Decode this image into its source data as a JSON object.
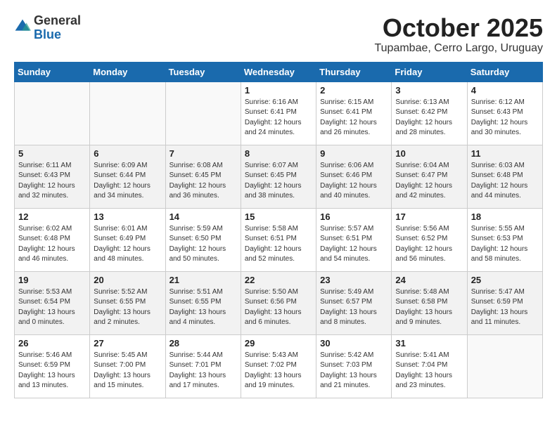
{
  "header": {
    "logo_general": "General",
    "logo_blue": "Blue",
    "month_title": "October 2025",
    "subtitle": "Tupambae, Cerro Largo, Uruguay"
  },
  "weekdays": [
    "Sunday",
    "Monday",
    "Tuesday",
    "Wednesday",
    "Thursday",
    "Friday",
    "Saturday"
  ],
  "weeks": [
    [
      {
        "day": "",
        "info": ""
      },
      {
        "day": "",
        "info": ""
      },
      {
        "day": "",
        "info": ""
      },
      {
        "day": "1",
        "info": "Sunrise: 6:16 AM\nSunset: 6:41 PM\nDaylight: 12 hours\nand 24 minutes."
      },
      {
        "day": "2",
        "info": "Sunrise: 6:15 AM\nSunset: 6:41 PM\nDaylight: 12 hours\nand 26 minutes."
      },
      {
        "day": "3",
        "info": "Sunrise: 6:13 AM\nSunset: 6:42 PM\nDaylight: 12 hours\nand 28 minutes."
      },
      {
        "day": "4",
        "info": "Sunrise: 6:12 AM\nSunset: 6:43 PM\nDaylight: 12 hours\nand 30 minutes."
      }
    ],
    [
      {
        "day": "5",
        "info": "Sunrise: 6:11 AM\nSunset: 6:43 PM\nDaylight: 12 hours\nand 32 minutes."
      },
      {
        "day": "6",
        "info": "Sunrise: 6:09 AM\nSunset: 6:44 PM\nDaylight: 12 hours\nand 34 minutes."
      },
      {
        "day": "7",
        "info": "Sunrise: 6:08 AM\nSunset: 6:45 PM\nDaylight: 12 hours\nand 36 minutes."
      },
      {
        "day": "8",
        "info": "Sunrise: 6:07 AM\nSunset: 6:45 PM\nDaylight: 12 hours\nand 38 minutes."
      },
      {
        "day": "9",
        "info": "Sunrise: 6:06 AM\nSunset: 6:46 PM\nDaylight: 12 hours\nand 40 minutes."
      },
      {
        "day": "10",
        "info": "Sunrise: 6:04 AM\nSunset: 6:47 PM\nDaylight: 12 hours\nand 42 minutes."
      },
      {
        "day": "11",
        "info": "Sunrise: 6:03 AM\nSunset: 6:48 PM\nDaylight: 12 hours\nand 44 minutes."
      }
    ],
    [
      {
        "day": "12",
        "info": "Sunrise: 6:02 AM\nSunset: 6:48 PM\nDaylight: 12 hours\nand 46 minutes."
      },
      {
        "day": "13",
        "info": "Sunrise: 6:01 AM\nSunset: 6:49 PM\nDaylight: 12 hours\nand 48 minutes."
      },
      {
        "day": "14",
        "info": "Sunrise: 5:59 AM\nSunset: 6:50 PM\nDaylight: 12 hours\nand 50 minutes."
      },
      {
        "day": "15",
        "info": "Sunrise: 5:58 AM\nSunset: 6:51 PM\nDaylight: 12 hours\nand 52 minutes."
      },
      {
        "day": "16",
        "info": "Sunrise: 5:57 AM\nSunset: 6:51 PM\nDaylight: 12 hours\nand 54 minutes."
      },
      {
        "day": "17",
        "info": "Sunrise: 5:56 AM\nSunset: 6:52 PM\nDaylight: 12 hours\nand 56 minutes."
      },
      {
        "day": "18",
        "info": "Sunrise: 5:55 AM\nSunset: 6:53 PM\nDaylight: 12 hours\nand 58 minutes."
      }
    ],
    [
      {
        "day": "19",
        "info": "Sunrise: 5:53 AM\nSunset: 6:54 PM\nDaylight: 13 hours\nand 0 minutes."
      },
      {
        "day": "20",
        "info": "Sunrise: 5:52 AM\nSunset: 6:55 PM\nDaylight: 13 hours\nand 2 minutes."
      },
      {
        "day": "21",
        "info": "Sunrise: 5:51 AM\nSunset: 6:55 PM\nDaylight: 13 hours\nand 4 minutes."
      },
      {
        "day": "22",
        "info": "Sunrise: 5:50 AM\nSunset: 6:56 PM\nDaylight: 13 hours\nand 6 minutes."
      },
      {
        "day": "23",
        "info": "Sunrise: 5:49 AM\nSunset: 6:57 PM\nDaylight: 13 hours\nand 8 minutes."
      },
      {
        "day": "24",
        "info": "Sunrise: 5:48 AM\nSunset: 6:58 PM\nDaylight: 13 hours\nand 9 minutes."
      },
      {
        "day": "25",
        "info": "Sunrise: 5:47 AM\nSunset: 6:59 PM\nDaylight: 13 hours\nand 11 minutes."
      }
    ],
    [
      {
        "day": "26",
        "info": "Sunrise: 5:46 AM\nSunset: 6:59 PM\nDaylight: 13 hours\nand 13 minutes."
      },
      {
        "day": "27",
        "info": "Sunrise: 5:45 AM\nSunset: 7:00 PM\nDaylight: 13 hours\nand 15 minutes."
      },
      {
        "day": "28",
        "info": "Sunrise: 5:44 AM\nSunset: 7:01 PM\nDaylight: 13 hours\nand 17 minutes."
      },
      {
        "day": "29",
        "info": "Sunrise: 5:43 AM\nSunset: 7:02 PM\nDaylight: 13 hours\nand 19 minutes."
      },
      {
        "day": "30",
        "info": "Sunrise: 5:42 AM\nSunset: 7:03 PM\nDaylight: 13 hours\nand 21 minutes."
      },
      {
        "day": "31",
        "info": "Sunrise: 5:41 AM\nSunset: 7:04 PM\nDaylight: 13 hours\nand 23 minutes."
      },
      {
        "day": "",
        "info": ""
      }
    ]
  ]
}
